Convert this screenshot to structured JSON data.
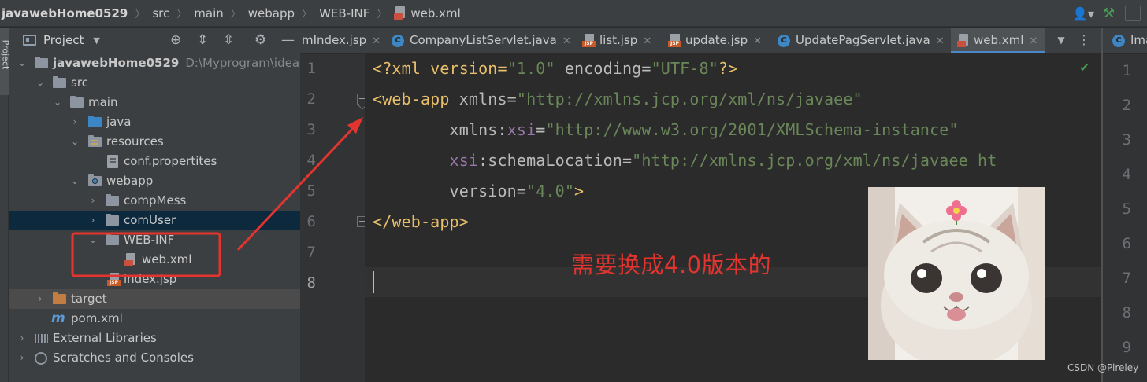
{
  "breadcrumb": [
    "javawebHome0529",
    "src",
    "main",
    "webapp",
    "WEB-INF",
    "web.xml"
  ],
  "left_stripe": {
    "label": "Project"
  },
  "project_panel": {
    "title": "Project",
    "tree": [
      {
        "label": "javawebHome0529",
        "path": "D:\\Myprogram\\idea-w"
      },
      {
        "label": "src"
      },
      {
        "label": "main"
      },
      {
        "label": "java"
      },
      {
        "label": "resources"
      },
      {
        "label": "conf.propertites"
      },
      {
        "label": "webapp"
      },
      {
        "label": "compMess"
      },
      {
        "label": "comUser"
      },
      {
        "label": "WEB-INF"
      },
      {
        "label": "web.xml"
      },
      {
        "label": "index.jsp"
      },
      {
        "label": "target"
      },
      {
        "label": "pom.xml"
      },
      {
        "label": "External Libraries"
      },
      {
        "label": "Scratches and Consoles"
      }
    ]
  },
  "tabs": [
    {
      "label": "mIndex.jsp"
    },
    {
      "label": "CompanyListServlet.java"
    },
    {
      "label": "list.jsp"
    },
    {
      "label": "update.jsp"
    },
    {
      "label": "UpdatePagServlet.java"
    },
    {
      "label": "web.xml"
    }
  ],
  "split_tab_label": "Ima",
  "editor": {
    "line_numbers": [
      "1",
      "2",
      "3",
      "4",
      "5",
      "6",
      "7",
      "8"
    ],
    "lines": [
      [
        "<?xml version=",
        "\"1.0\"",
        " encoding=",
        "\"UTF-8\"",
        "?>"
      ],
      [
        "<web-app",
        " xmlns=",
        "\"http://xmlns.jcp.org/xml/ns/javaee\""
      ],
      [
        "        xmlns:",
        "xsi",
        "=",
        "\"http://www.w3.org/2001/XMLSchema-instance\""
      ],
      [
        "        ",
        "xsi",
        ":schemaLocation=",
        "\"http://xmlns.jcp.org/xml/ns/javaee ht"
      ],
      [
        "        version=",
        "\"4.0\"",
        ">"
      ],
      [
        "</web-app>"
      ],
      [
        ""
      ],
      [
        ""
      ]
    ]
  },
  "split_line_numbers": [
    "1",
    "2",
    "3",
    "4",
    "5",
    "6",
    "7",
    "8",
    "9"
  ],
  "annotation": "需要换成4.0版本的",
  "watermark": "CSDN @Pireley",
  "colors": {
    "annotation_red": "#e3342f",
    "active_tab_accent": "#4a88c7",
    "selection_bg": "#0d293e"
  }
}
